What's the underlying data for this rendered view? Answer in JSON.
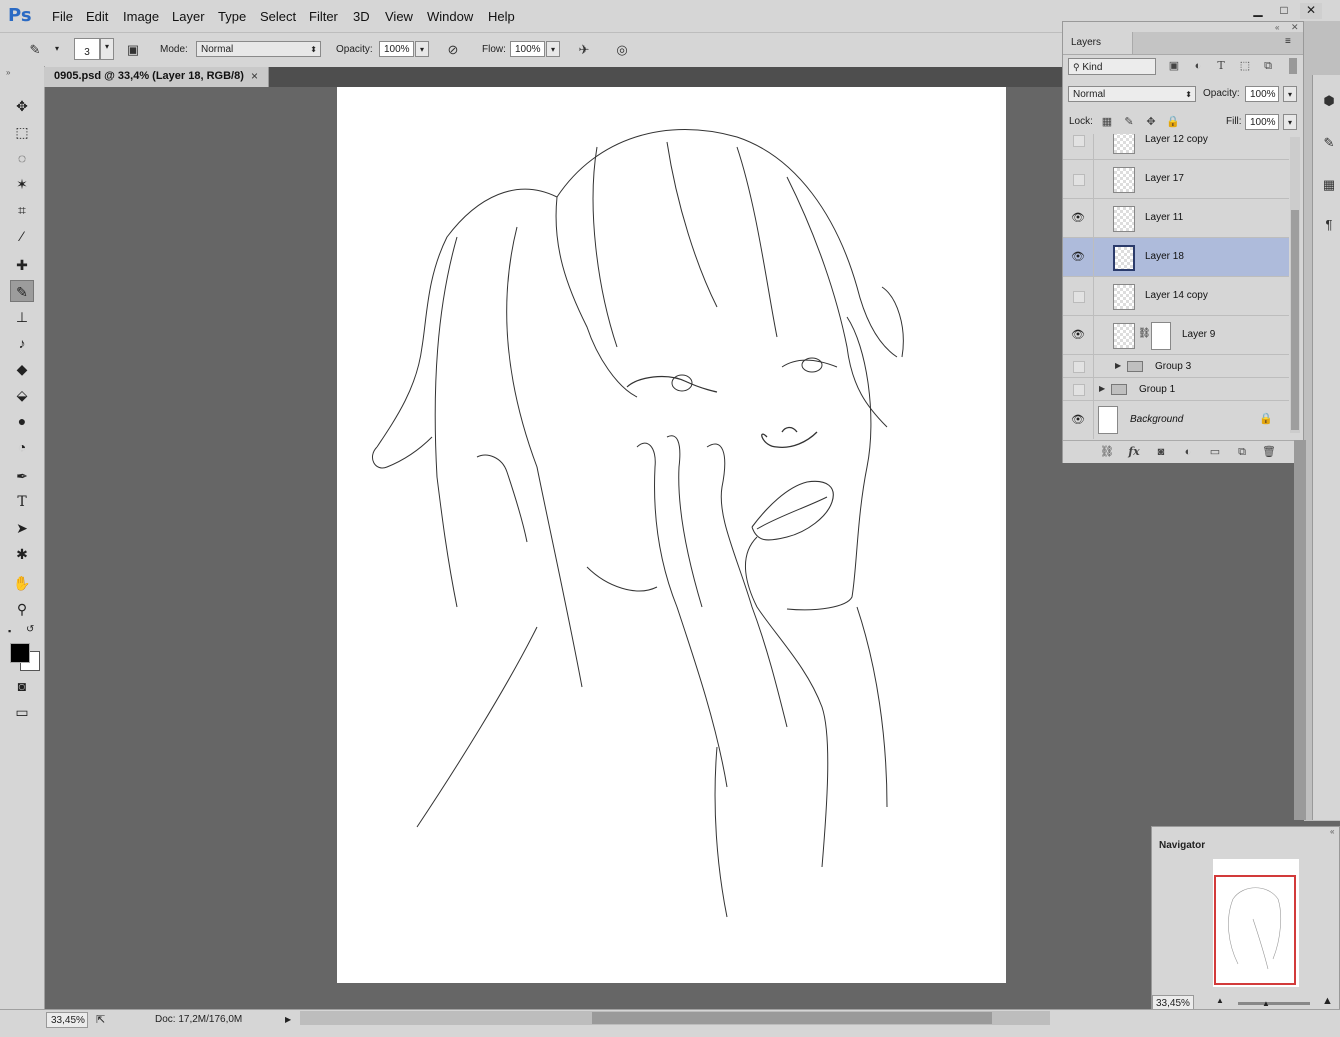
{
  "app": {
    "logo": "Ps"
  },
  "menu": [
    "File",
    "Edit",
    "Image",
    "Layer",
    "Type",
    "Select",
    "Filter",
    "3D",
    "View",
    "Window",
    "Help"
  ],
  "options": {
    "brush_size": "3",
    "mode_label": "Mode:",
    "mode_value": "Normal",
    "opacity_label": "Opacity:",
    "opacity_value": "100%",
    "flow_label": "Flow:",
    "flow_value": "100%"
  },
  "document_tab": {
    "title": "0905.psd @ 33,4% (Layer 18, RGB/8)",
    "close": "×"
  },
  "layers_panel": {
    "tab": "Layers",
    "filter_kind": "Kind",
    "blend_mode": "Normal",
    "opacity_label": "Opacity:",
    "opacity_value": "100%",
    "lock_label": "Lock:",
    "fill_label": "Fill:",
    "fill_value": "100%",
    "layers": [
      {
        "name": "Layer 12 copy",
        "visible": false
      },
      {
        "name": "Layer 17",
        "visible": false
      },
      {
        "name": "Layer 11",
        "visible": true
      },
      {
        "name": "Layer 18",
        "visible": true,
        "selected": true
      },
      {
        "name": "Layer 14 copy",
        "visible": false
      },
      {
        "name": "Layer 9",
        "visible": true,
        "has_mask": true
      },
      {
        "name": "Group 3",
        "visible": false,
        "group": true
      },
      {
        "name": "Group 1",
        "visible": false,
        "group": true
      },
      {
        "name": "Background",
        "visible": true,
        "locked": true
      }
    ]
  },
  "navigator": {
    "tab": "Navigator",
    "zoom": "33,45%"
  },
  "status": {
    "zoom": "33,45%",
    "doc": "Doc: 17,2M/176,0M"
  },
  "colors": {
    "accent_selection": "#aebbdb",
    "nav_frame": "#d23a3a",
    "logo": "#2a6ac4"
  }
}
